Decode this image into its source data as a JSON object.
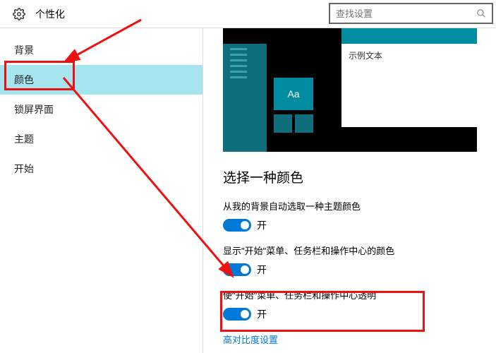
{
  "header": {
    "title": "个性化"
  },
  "search": {
    "placeholder": "查找设置"
  },
  "sidebar": {
    "items": [
      {
        "label": "背景"
      },
      {
        "label": "颜色"
      },
      {
        "label": "锁屏界面"
      },
      {
        "label": "主题"
      },
      {
        "label": "开始"
      }
    ]
  },
  "preview": {
    "tile_text": "Aa",
    "sample_text": "示例文本"
  },
  "section": {
    "title": "选择一种颜色"
  },
  "settings": {
    "auto_color": {
      "label": "从我的背景自动选取一种主题颜色",
      "state": "开"
    },
    "show_color": {
      "label": "显示\"开始\"菜单、任务栏和操作中心的颜色",
      "state": "开"
    },
    "transparent": {
      "label": "使\"开始\"菜单、任务栏和操作中心透明",
      "state": "开"
    }
  },
  "contrast_link": "高对比度设置"
}
